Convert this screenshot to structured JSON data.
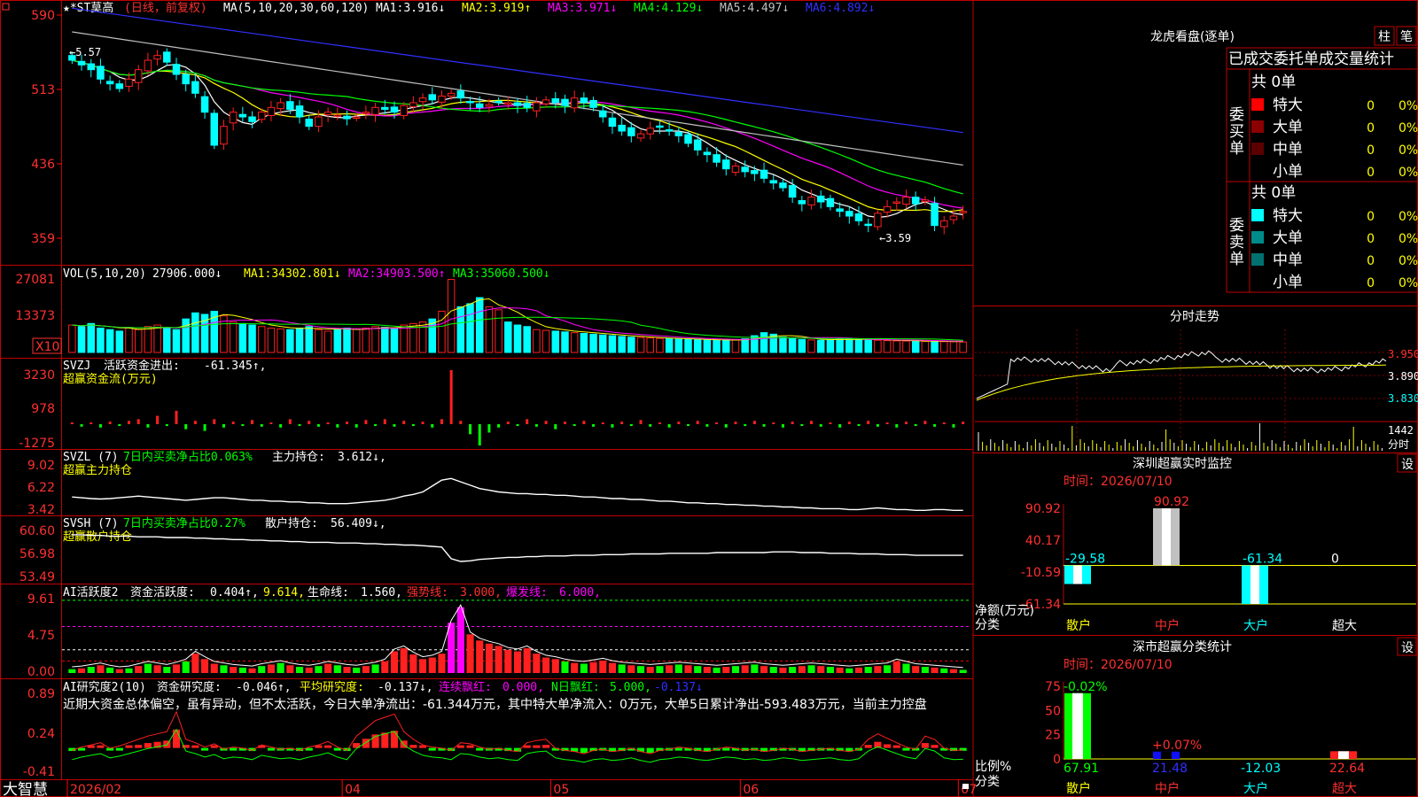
{
  "title_bar": {
    "stock_name": "★*ST莫高",
    "period": "(日线，前复权)",
    "ma_label": "MA(5,10,20,30,60,120)",
    "ma_values": [
      {
        "label": "MA1:",
        "value": "3.916↓",
        "color": "#ffffff"
      },
      {
        "label": "MA2:",
        "value": "3.919↑",
        "color": "#ffff00"
      },
      {
        "label": "MA3:",
        "value": "3.971↓",
        "color": "#ff00ff"
      },
      {
        "label": "MA4:",
        "value": "4.129↓",
        "color": "#00ff00"
      },
      {
        "label": "MA5:",
        "value": "4.497↓",
        "color": "#c0c0c0"
      },
      {
        "label": "MA6:",
        "value": "4.892↓",
        "color": "#3030ff"
      }
    ]
  },
  "colors": {
    "up": "#ff2020",
    "down": "#00ffff",
    "axis": "#ff0000",
    "grid": "#400000",
    "text": "#ffffff"
  },
  "price_axis": {
    "ticks": [
      "590",
      "513",
      "436",
      "359"
    ]
  },
  "price_annotations": {
    "high": "←5.57",
    "low": "←3.59"
  },
  "volume_panel": {
    "header": "VOL(5,10,20)",
    "value": "27906.000↓",
    "ma": [
      {
        "label": "MA1:",
        "value": "34302.801↓",
        "color": "#ffff00"
      },
      {
        "label": "MA2:",
        "value": "34903.500↑",
        "color": "#ff00ff"
      },
      {
        "label": "MA3:",
        "value": "35060.500↓",
        "color": "#00ff00"
      }
    ],
    "ticks": [
      "27081",
      "13373"
    ],
    "unit": "X10"
  },
  "svzj_panel": {
    "name": "SVZJ",
    "desc": "活跃资金进出:",
    "value": "-61.345↑,",
    "subtitle": "超赢资金流(万元)",
    "ticks": [
      "3230",
      "978",
      "-1275"
    ]
  },
  "svzl_panel": {
    "name": "SVZL (7)",
    "desc": "7日内买卖净占比0.063%",
    "extra": "主力持仓:",
    "value": "3.612↓,",
    "subtitle": "超赢主力持仓",
    "ticks": [
      "9.02",
      "6.22",
      "3.42"
    ]
  },
  "svsh_panel": {
    "name": "SVSH (7)",
    "desc": "7日内买卖净占比0.27%",
    "extra": "散户持仓:",
    "value": "56.409↓,",
    "subtitle": "超赢散户持仓",
    "ticks": [
      "60.60",
      "56.98",
      "53.49"
    ]
  },
  "ai_active_panel": {
    "name": "AI活跃度2",
    "desc": "资金活跃度:",
    "value": "0.404↑,",
    "v2": "9.614,",
    "life": "生命线:",
    "life_v": "1.560,",
    "strong": "强势线:",
    "strong_v": "3.000,",
    "burst": "爆发线:",
    "burst_v": "6.000,",
    "ticks": [
      "9.61",
      "4.75",
      "0.00"
    ]
  },
  "ai_research_panel": {
    "name": "AI研究度2(10)",
    "desc": "资金研究度:",
    "value": "-0.046↑,",
    "avg": "平均研究度:",
    "avg_v": "-0.137↓,",
    "red": "连续飘红:",
    "red_v": "0.000,",
    "nred": "N日飘红:",
    "nred_v": "5.000,",
    "last": "-0.137↓",
    "summary": "近期大资金总体偏空，虽有异动，但不太活跃，今日大单净流出：-61.344万元，其中特大单净流入：0万元，大单5日累计净出-593.483万元，当前主力控盘",
    "ticks": [
      "0.89",
      "0.24",
      "-0.41"
    ]
  },
  "date_axis": {
    "labels": [
      "2026/02",
      "04",
      "05",
      "06",
      "07"
    ]
  },
  "footer_brand": "大智慧",
  "right_panel": {
    "lhb_title": "龙虎看盘(逐单)",
    "tabs": [
      "柱",
      "笔"
    ],
    "stats_title": "已成交委托单成交量统计",
    "buy_side": {
      "label": "委买单",
      "total": "共 0单",
      "rows": [
        {
          "name": "特大",
          "count": "0",
          "pct": "0%",
          "color": "#ff0000"
        },
        {
          "name": "大单",
          "count": "0",
          "pct": "0%",
          "color": "#8b0000"
        },
        {
          "name": "中单",
          "count": "0",
          "pct": "0%",
          "color": "#5a0000"
        },
        {
          "name": "小单",
          "count": "0",
          "pct": "0%",
          "color": ""
        }
      ]
    },
    "sell_side": {
      "label": "委卖单",
      "total": "共 0单",
      "rows": [
        {
          "name": "特大",
          "count": "0",
          "pct": "0%",
          "color": "#00ffff"
        },
        {
          "name": "大单",
          "count": "0",
          "pct": "0%",
          "color": "#008b8b"
        },
        {
          "name": "中单",
          "count": "0",
          "pct": "0%",
          "color": "#007070"
        },
        {
          "name": "小单",
          "count": "0",
          "pct": "0%",
          "color": ""
        }
      ]
    },
    "intraday": {
      "title": "分时走势",
      "ticks": [
        "3.950",
        "3.890",
        "3.830"
      ],
      "vol_tick": "1442",
      "unit": "分时"
    },
    "monitor": {
      "title": "深圳超赢实时监控",
      "set": "设",
      "time": "时间：2026/07/10",
      "ticks": [
        "90.92",
        "40.17",
        "-10.59",
        "-61.34"
      ],
      "y_label": "净额(万元)",
      "x_label": "分类",
      "categories": [
        "散户",
        "中户",
        "大户",
        "超大"
      ],
      "values": [
        "-29.58",
        "90.92",
        "-61.34",
        "0"
      ]
    },
    "classify": {
      "title": "深市超赢分类统计",
      "set": "设",
      "time": "时间：2026/07/10",
      "ticks": [
        "75",
        "50",
        "25",
        "0"
      ],
      "y_label": "比例%",
      "x_label": "分类",
      "categories": [
        "散户",
        "中户",
        "大户",
        "超大"
      ],
      "top_labels": [
        "-0.02%",
        "+0.07%",
        "",
        ""
      ],
      "values": [
        "67.91",
        "21.48",
        "-12.03",
        "22.64"
      ]
    }
  },
  "chart_data": [
    {
      "type": "candlestick",
      "title": "★*ST莫高",
      "ylabel": "price",
      "ylim": [
        3.4,
        5.95
      ],
      "series": [
        {
          "name": "MA1",
          "color": "#ffffff"
        },
        {
          "name": "MA2",
          "color": "#ffff00"
        },
        {
          "name": "MA3",
          "color": "#ff00ff"
        },
        {
          "name": "MA4",
          "color": "#00ff00"
        },
        {
          "name": "MA5",
          "color": "#c0c0c0"
        },
        {
          "name": "MA6",
          "color": "#3030ff"
        }
      ],
      "close": [
        5.5,
        5.45,
        5.4,
        5.3,
        5.25,
        5.2,
        5.3,
        5.4,
        5.5,
        5.55,
        5.48,
        5.35,
        5.25,
        5.15,
        4.95,
        4.6,
        4.8,
        4.95,
        4.9,
        4.85,
        4.95,
        5.0,
        5.05,
        4.98,
        4.9,
        4.8,
        4.9,
        4.95,
        4.92,
        4.88,
        4.9,
        4.95,
        5.0,
        4.98,
        4.95,
        5.02,
        5.05,
        5.1,
        5.08,
        5.12,
        5.15,
        5.1,
        5.05,
        5.0,
        5.03,
        5.06,
        5.05,
        5.02,
        5.0,
        5.05,
        5.08,
        5.05,
        5.02,
        5.1,
        5.05,
        5.0,
        4.9,
        4.8,
        4.75,
        4.7,
        4.72,
        4.78,
        4.8,
        4.75,
        4.7,
        4.62,
        4.55,
        4.5,
        4.42,
        4.35,
        4.38,
        4.32,
        4.3,
        4.25,
        4.2,
        4.15,
        4.05,
        3.98,
        4.05,
        4.0,
        3.95,
        3.9,
        3.85,
        3.8,
        3.75,
        3.88,
        3.95,
        4.0,
        4.05,
        3.98,
        4.02,
        3.75,
        3.8,
        3.85,
        3.9
      ]
    },
    {
      "type": "bar",
      "title": "VOL",
      "values": [
        18000,
        17000,
        19000,
        16000,
        15000,
        14000,
        16000,
        15000,
        17000,
        18000,
        16000,
        15000,
        22000,
        26000,
        25000,
        27000,
        24000,
        20000,
        19000,
        18000,
        17000,
        16000,
        15500,
        15000,
        16000,
        17000,
        15000,
        14000,
        15000,
        16000,
        15500,
        16000,
        17000,
        16500,
        16000,
        18000,
        19000,
        20000,
        22000,
        27081,
        48000,
        30000,
        32000,
        36000,
        30000,
        28000,
        20000,
        18000,
        17000,
        15000,
        14500,
        14000,
        13500,
        13000,
        12500,
        12000,
        11500,
        11000,
        10500,
        10000,
        9800,
        9500,
        9200,
        9000,
        8800,
        8600,
        8400,
        8200,
        8000,
        7900,
        8200,
        9000,
        11000,
        13000,
        12000,
        10000,
        9000,
        8500,
        8200,
        8000,
        8500,
        9000,
        8800,
        8500,
        8200,
        8000,
        7800,
        7600,
        7500,
        7400,
        7300,
        7200,
        7100,
        7000,
        6900
      ]
    },
    {
      "type": "bar",
      "title": "超赢资金流(万元)",
      "values": [
        0,
        -150,
        100,
        -200,
        150,
        -100,
        200,
        300,
        -200,
        500,
        -100,
        800,
        -300,
        200,
        -400,
        300,
        -200,
        150,
        -100,
        250,
        -150,
        100,
        -200,
        300,
        -100,
        200,
        -150,
        100,
        -200,
        150,
        -200,
        250,
        -100,
        300,
        -150,
        200,
        -100,
        150,
        -200,
        300,
        3230,
        200,
        -600,
        -1275,
        -500,
        -200,
        150,
        -100,
        300,
        -150,
        200,
        -300,
        150,
        -100,
        200,
        -150,
        100,
        -200,
        150,
        -100,
        250,
        -150,
        100,
        -200,
        150,
        -100,
        200,
        -150,
        100,
        -200,
        150,
        -100,
        200,
        -150,
        100,
        -200,
        150,
        -100,
        200,
        -150,
        100,
        -200,
        150,
        -100,
        200,
        -150,
        100,
        -200,
        150,
        -100,
        200,
        -150,
        100,
        -200,
        150
      ]
    },
    {
      "type": "line",
      "title": "超赢主力持仓",
      "ylim": [
        3.42,
        9.02
      ],
      "values": [
        5.2,
        5.1,
        5.0,
        4.95,
        5.0,
        5.1,
        5.2,
        5.3,
        5.2,
        5.1,
        5.0,
        4.9,
        4.8,
        4.9,
        5.0,
        5.1,
        5.1,
        5.0,
        4.9,
        4.8,
        4.8,
        4.7,
        4.7,
        4.6,
        4.6,
        4.5,
        4.5,
        4.4,
        4.4,
        4.4,
        4.5,
        4.6,
        4.7,
        4.8,
        5.0,
        5.3,
        5.5,
        5.8,
        6.5,
        7.2,
        7.4,
        7.0,
        6.6,
        6.2,
        6.0,
        5.8,
        5.7,
        5.6,
        5.6,
        5.5,
        5.5,
        5.4,
        5.4,
        5.3,
        5.2,
        5.2,
        5.1,
        5.0,
        5.0,
        4.9,
        4.9,
        4.8,
        4.7,
        4.7,
        4.6,
        4.5,
        4.5,
        4.4,
        4.4,
        4.3,
        4.3,
        4.2,
        4.2,
        4.1,
        4.1,
        4.0,
        4.0,
        3.9,
        3.9,
        3.8,
        3.8,
        3.8,
        3.7,
        3.7,
        3.8,
        3.9,
        3.8,
        3.7,
        3.7,
        3.6,
        3.6,
        3.7,
        3.7,
        3.6,
        3.6
      ]
    },
    {
      "type": "line",
      "title": "超赢散户持仓",
      "ylim": [
        53.49,
        60.6
      ],
      "values": [
        60.1,
        60.1,
        60.0,
        60.0,
        59.9,
        59.9,
        59.9,
        59.8,
        59.8,
        59.8,
        59.7,
        59.7,
        59.7,
        59.6,
        59.6,
        59.5,
        59.5,
        59.4,
        59.4,
        59.3,
        59.3,
        59.2,
        59.2,
        59.1,
        59.1,
        59.0,
        59.0,
        59.0,
        58.9,
        58.9,
        58.9,
        58.8,
        58.8,
        58.7,
        58.7,
        58.6,
        58.6,
        58.5,
        58.4,
        58.3,
        56.6,
        56.2,
        56.3,
        56.5,
        56.6,
        56.7,
        56.8,
        56.8,
        56.9,
        56.9,
        57.0,
        57.0,
        57.0,
        57.1,
        57.1,
        57.1,
        57.2,
        57.2,
        57.2,
        57.3,
        57.3,
        57.3,
        57.3,
        57.4,
        57.4,
        57.4,
        57.4,
        57.4,
        57.5,
        57.5,
        57.5,
        57.5,
        57.5,
        57.5,
        57.6,
        57.6,
        57.6,
        57.5,
        57.5,
        57.5,
        57.4,
        57.4,
        57.4,
        57.3,
        57.3,
        57.3,
        57.2,
        57.2,
        57.2,
        57.1,
        57.1,
        57.1,
        57.1,
        57.1,
        57.1
      ]
    },
    {
      "type": "bar",
      "title": "资金活跃度",
      "ylim": [
        0,
        9.61
      ],
      "values": [
        0.5,
        0.6,
        0.8,
        1.0,
        0.7,
        0.5,
        0.6,
        0.9,
        1.2,
        1.0,
        0.8,
        1.1,
        1.5,
        2.5,
        1.8,
        1.2,
        1.0,
        0.8,
        0.7,
        0.6,
        0.9,
        1.1,
        1.3,
        1.0,
        0.8,
        0.7,
        0.9,
        1.2,
        1.0,
        0.8,
        0.7,
        0.9,
        1.1,
        1.5,
        2.8,
        3.2,
        2.4,
        1.8,
        2.0,
        2.5,
        6.5,
        8.5,
        5.0,
        4.2,
        3.8,
        3.5,
        3.0,
        2.8,
        3.2,
        2.5,
        2.0,
        1.8,
        1.5,
        1.3,
        1.2,
        1.4,
        1.6,
        1.3,
        1.1,
        1.0,
        0.9,
        0.8,
        0.9,
        1.0,
        1.1,
        1.0,
        0.9,
        0.8,
        0.7,
        0.8,
        0.9,
        1.0,
        1.1,
        0.9,
        0.8,
        0.7,
        0.8,
        0.9,
        1.0,
        0.9,
        0.8,
        0.7,
        0.6,
        0.7,
        0.8,
        0.9,
        1.0,
        1.5,
        1.2,
        0.9,
        0.8,
        0.7,
        0.6,
        0.5,
        0.404
      ]
    },
    {
      "type": "bar",
      "title": "资金研究度",
      "ylim": [
        -0.41,
        0.89
      ],
      "values": [
        -0.05,
        -0.02,
        0.0,
        0.02,
        -0.03,
        -0.01,
        0.02,
        0.05,
        0.08,
        0.1,
        0.12,
        0.3,
        0.05,
        0.02,
        -0.02,
        0.01,
        -0.04,
        -0.02,
        -0.03,
        -0.05,
        0.0,
        -0.02,
        -0.04,
        -0.03,
        -0.05,
        -0.02,
        0.0,
        0.03,
        -0.02,
        -0.05,
        0.08,
        0.15,
        0.22,
        0.25,
        0.28,
        0.12,
        0.05,
        0.0,
        -0.02,
        -0.03,
        -0.05,
        0.02,
        0.01,
        -0.02,
        -0.04,
        -0.03,
        -0.05,
        -0.06,
        0.02,
        0.04,
        0.05,
        -0.03,
        -0.05,
        -0.06,
        -0.08,
        -0.05,
        -0.04,
        -0.06,
        -0.05,
        -0.03,
        -0.06,
        -0.08,
        -0.05,
        -0.04,
        -0.02,
        -0.03,
        -0.05,
        -0.06,
        -0.04,
        -0.02,
        -0.03,
        -0.05,
        -0.04,
        -0.06,
        -0.05,
        -0.03,
        -0.04,
        -0.06,
        -0.05,
        -0.04,
        -0.03,
        -0.05,
        -0.06,
        -0.04,
        0.05,
        0.1,
        0.06,
        0.02,
        -0.02,
        -0.04,
        0.08,
        0.05,
        -0.03,
        -0.05,
        -0.046
      ]
    }
  ]
}
